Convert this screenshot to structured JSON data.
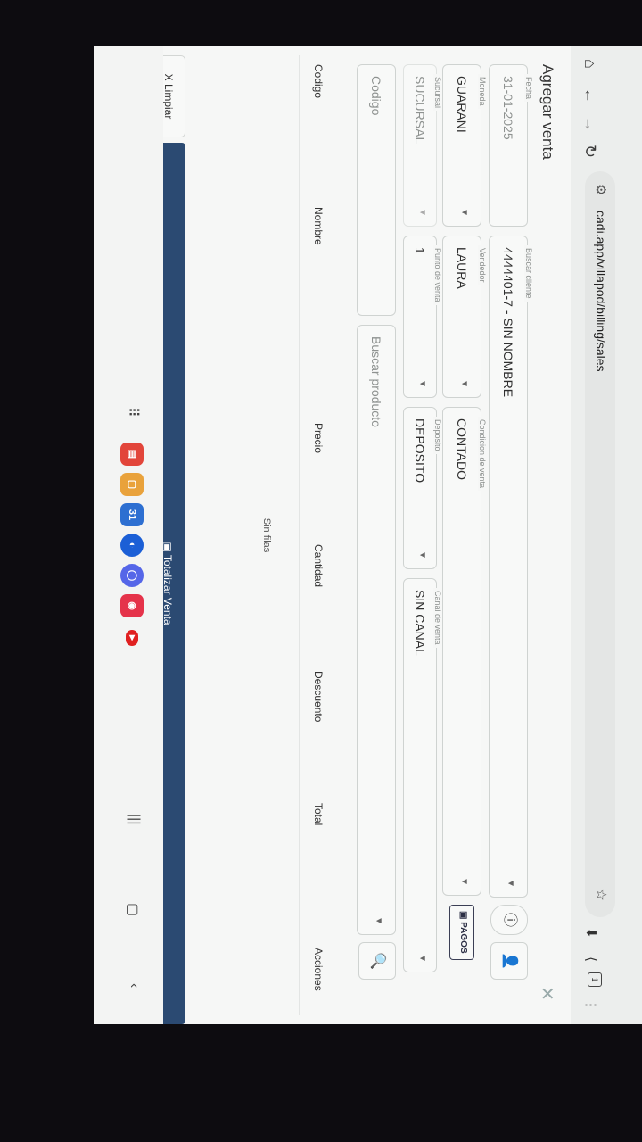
{
  "browser": {
    "url": "cadi.app/villapod/billing/sales",
    "icons": [
      "home-icon",
      "back-icon",
      "forward-icon",
      "reload-icon",
      "site-settings-icon",
      "star-icon",
      "download-icon",
      "share-icon",
      "tabs-icon",
      "menu-icon"
    ],
    "tab_count": "1"
  },
  "page": {
    "title": "Agregar venta",
    "close_label": "✕"
  },
  "form": {
    "fecha": {
      "label": "Fecha",
      "value": "31-01-2025"
    },
    "cliente": {
      "label": "Buscar cliente",
      "value": "4444401-7 - SIN NOMBRE"
    },
    "moneda": {
      "label": "Moneda",
      "value": "GUARANI"
    },
    "vendedor": {
      "label": "Vendedor",
      "value": "LAURA"
    },
    "condicion": {
      "label": "Condicion de venta",
      "value": "CONTADO"
    },
    "sucursal": {
      "label": "Sucursal",
      "value": "SUCURSAL"
    },
    "punto": {
      "label": "Punto de venta",
      "value": "1"
    },
    "deposito": {
      "label": "Deposito",
      "value": "DEPOSITO"
    },
    "canal": {
      "label": "Canal de venta",
      "value": "SIN CANAL"
    },
    "codigo": {
      "placeholder": "Codigo"
    },
    "producto": {
      "placeholder": "Buscar producto"
    },
    "pagos_label": "PAGOS"
  },
  "table": {
    "columns": [
      "Codigo",
      "Nombre",
      "Precio",
      "Cantidad",
      "Descuento",
      "Total",
      "Acciones"
    ],
    "empty_text": "Sin filas"
  },
  "actions": {
    "limpiar": "X Limpiar",
    "totalizar": "Totalizar Venta"
  },
  "taskbar": {
    "calendar_day": "31"
  }
}
